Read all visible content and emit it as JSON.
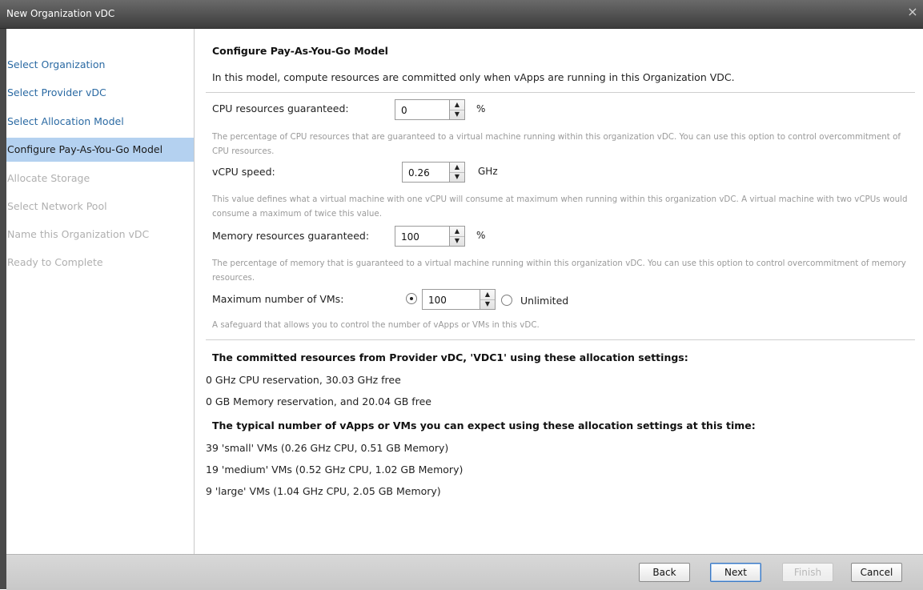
{
  "window": {
    "title": "New Organization vDC",
    "close_glyph": "×"
  },
  "sidebar": {
    "items": [
      {
        "label": "Select Organization",
        "state": "link"
      },
      {
        "label": "Select Provider vDC",
        "state": "link"
      },
      {
        "label": "Select Allocation Model",
        "state": "link"
      },
      {
        "label": "Configure Pay-As-You-Go Model",
        "state": "active"
      },
      {
        "label": "Allocate Storage",
        "state": "disabled"
      },
      {
        "label": "Select Network Pool",
        "state": "disabled"
      },
      {
        "label": "Name this Organization vDC",
        "state": "disabled"
      },
      {
        "label": "Ready to Complete",
        "state": "disabled"
      }
    ]
  },
  "main": {
    "heading": "Configure Pay-As-You-Go Model",
    "description": "In this model, compute resources are committed only when vApps are running in this Organization VDC.",
    "cpu": {
      "label": "CPU resources guaranteed:",
      "value": "0",
      "unit": "%",
      "hint": "The percentage of CPU resources that are guaranteed to a virtual machine running within this organization vDC. You can use this option to control overcommitment of CPU resources."
    },
    "vcpu": {
      "label": "vCPU speed:",
      "value": "0.26",
      "unit": "GHz",
      "hint": "This value defines what a virtual machine with one vCPU will consume at maximum when running within this organization vDC. A virtual machine with two vCPUs would consume a maximum of twice this value."
    },
    "memory": {
      "label": "Memory resources guaranteed:",
      "value": "100",
      "unit": "%",
      "hint": "The percentage of memory that is guaranteed to a virtual machine running within this organization vDC. You can use this option to control overcommitment of memory resources."
    },
    "max_vms": {
      "label": "Maximum number of VMs:",
      "value": "100",
      "selected": "limited",
      "unlimited_label": "Unlimited",
      "hint": "A safeguard that allows you to control the number of vApps or VMs in this vDC."
    },
    "committed": {
      "heading": "The committed resources from Provider vDC, 'VDC1' using these allocation settings:",
      "cpu_line": "0 GHz CPU reservation, 30.03 GHz free",
      "mem_line": "0 GB Memory reservation, and 20.04 GB free"
    },
    "typical": {
      "heading": "The typical number of vApps or VMs you can expect using these allocation settings at this time:",
      "lines": [
        "39 'small' VMs (0.26 GHz CPU, 0.51 GB Memory)",
        "19 'medium' VMs (0.52 GHz CPU, 1.02 GB Memory)",
        "9 'large' VMs (1.04 GHz CPU, 2.05 GB Memory)"
      ]
    }
  },
  "footer": {
    "back_label": "Back",
    "next_label": "Next",
    "finish_label": "Finish",
    "cancel_label": "Cancel"
  }
}
